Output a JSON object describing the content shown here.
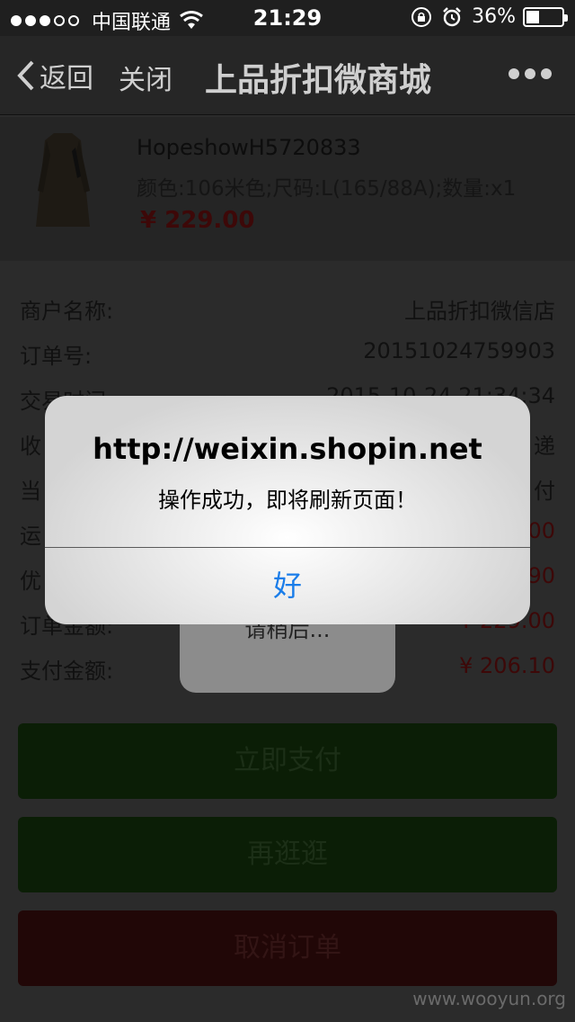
{
  "status_bar": {
    "carrier": "中国联通",
    "time": "21:29",
    "battery_percent": "36%",
    "signal_bars_filled": 3,
    "signal_bars_total": 5,
    "battery_level": 0.36
  },
  "nav": {
    "back_label": "返回",
    "close_label": "关闭",
    "title": "上品折扣微商城"
  },
  "product": {
    "name": "HopeshowH5720833",
    "spec": "颜色:106米色;尺码:L(165/88A);数量:x1",
    "price": "¥ 229.00"
  },
  "order_info": {
    "merchant_label": "商户名称:",
    "merchant_value": "上品折扣微信店",
    "order_no_label": "订单号:",
    "order_no_value": "20151024759903",
    "time_label": "交易时间:",
    "time_value": "2015-10-24 21:34:34",
    "receive_label": "收",
    "receive_value": "递",
    "status_label": "当",
    "status_value": "付",
    "freight_label": "运",
    "freight_value": "00",
    "discount_label": "优",
    "discount_value": "90",
    "order_amount_label": "订单金额:",
    "order_amount_value": "¥ 229.00",
    "pay_amount_label": "支付金额:",
    "pay_amount_value": "¥  206.10"
  },
  "buttons": {
    "pay_now": "立即支付",
    "browse_more": "再逛逛",
    "cancel_order": "取消订单"
  },
  "loading": {
    "text": "请稍后..."
  },
  "alert": {
    "title": "http://weixin.shopin.net",
    "message": "操作成功，即将刷新页面！",
    "ok": "好"
  },
  "watermark": "www.wooyun.org",
  "icons": {
    "wifi": "wifi-icon",
    "lock": "orientation-lock-icon",
    "alarm": "alarm-icon",
    "back": "chevron-left-icon",
    "more": "more-dots-icon"
  }
}
